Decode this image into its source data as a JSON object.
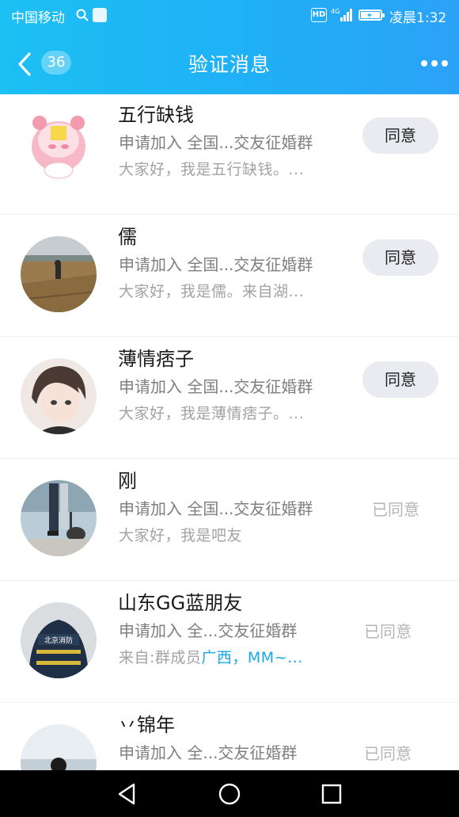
{
  "status_bar": {
    "carrier": "中国移动",
    "network": "4G",
    "hd": "HD",
    "time": "凌晨1:32"
  },
  "header": {
    "back_badge": "36",
    "title": "验证消息"
  },
  "requests": [
    {
      "name": "五行缺钱",
      "request": "申请加入 全国...交友征婚群",
      "message": "大家好，我是五行缺钱。...",
      "action": "同意",
      "status": "pending"
    },
    {
      "name": "儒",
      "request": "申请加入 全国...交友征婚群",
      "message": "大家好，我是儒。来自湖...",
      "action": "同意",
      "status": "pending"
    },
    {
      "name": "薄情痞子",
      "request": "申请加入 全国...交友征婚群",
      "message": "大家好，我是薄情痞子。...",
      "action": "同意",
      "status": "pending"
    },
    {
      "name": "刚",
      "request": "申请加入 全国...交友征婚群",
      "message": "大家好，我是吧友",
      "action": "已同意",
      "status": "agreed"
    },
    {
      "name": "山东GG蓝朋友",
      "request": "申请加入 全...交友征婚群",
      "message_prefix": "来自:群成员",
      "message_highlight": "广西，MM~...",
      "action": "已同意",
      "status": "agreed"
    },
    {
      "name": "丷锦年",
      "request": "申请加入 全...交友征婚群",
      "action": "已同意",
      "status": "agreed"
    }
  ],
  "colors": {
    "header_start": "#1cc0f3",
    "header_end": "#2ba2f8",
    "highlight": "#17a8e8",
    "agree_button_bg": "#eaeaf1"
  },
  "icons": {
    "back": "chevron-left-icon",
    "more": "more-dots-icon",
    "nav_back": "triangle-back-icon",
    "nav_home": "circle-home-icon",
    "nav_recents": "square-recents-icon"
  }
}
